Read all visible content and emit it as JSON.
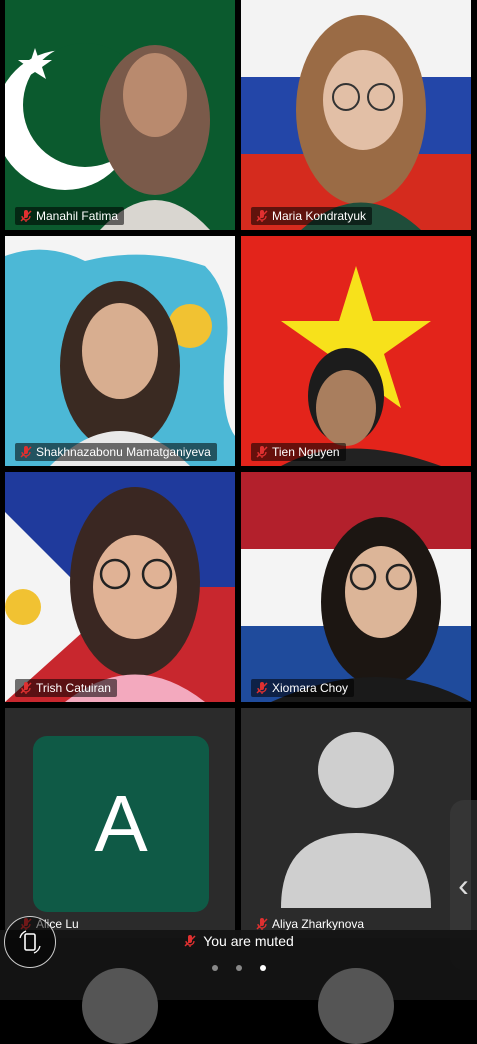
{
  "participants": [
    {
      "name": "Manahil Fatima"
    },
    {
      "name": "Maria Kondratyuk"
    },
    {
      "name": "Shakhnazabonu Mamatganiyeva"
    },
    {
      "name": "Tien Nguyen"
    },
    {
      "name": "Trish Catuiran"
    },
    {
      "name": "Xiomara Choy"
    },
    {
      "name": "Alice Lu",
      "avatar_letter": "A"
    },
    {
      "name": "Aliya Zharkynova"
    }
  ],
  "status": {
    "muted_text": "You are muted"
  },
  "pager": {
    "pages": 3,
    "active": 3
  },
  "icons": {
    "muted_mic": "mic-off-icon",
    "rotate": "rotate-screen-icon",
    "next": "chevron-left-icon"
  },
  "colors": {
    "mic_off": "#e03030",
    "avatar_bg": "#0f5a46"
  }
}
